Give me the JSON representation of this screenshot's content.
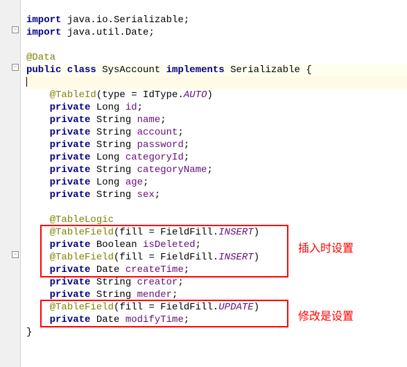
{
  "code": {
    "line1": "import java.io.Serializable;",
    "line1_kw": "import",
    "line1_pkg": " java.io.Serializable;",
    "line2_kw": "import",
    "line2_pkg": " java.util.Date;",
    "line4_ann": "@Data",
    "line5_kw1": "public class",
    "line5_cls": " SysAccount ",
    "line5_kw2": "implements",
    "line5_impl": " Serializable {",
    "line7_ann": "@TableId",
    "line7_paren1": "(type = IdType.",
    "line7_enum": "AUTO",
    "line7_paren2": ")",
    "line8_kw": "private",
    "line8_type": " Long ",
    "line8_field": "id",
    "line8_semi": ";",
    "line9_kw": "private",
    "line9_type": " String ",
    "line9_field": "name",
    "line9_semi": ";",
    "line10_kw": "private",
    "line10_type": " String ",
    "line10_field": "account",
    "line10_semi": ";",
    "line11_kw": "private",
    "line11_type": " String ",
    "line11_field": "password",
    "line11_semi": ";",
    "line12_kw": "private",
    "line12_type": " Long ",
    "line12_field": "categoryId",
    "line12_semi": ";",
    "line13_kw": "private",
    "line13_type": " String ",
    "line13_field": "categoryName",
    "line13_semi": ";",
    "line14_kw": "private",
    "line14_type": " Long ",
    "line14_field": "age",
    "line14_semi": ";",
    "line15_kw": "private",
    "line15_type": " String ",
    "line15_field": "sex",
    "line15_semi": ";",
    "line17_ann": "@TableLogic",
    "line18_ann": "@TableField",
    "line18_paren1": "(fill = FieldFill.",
    "line18_enum": "INSERT",
    "line18_paren2": ")",
    "line19_kw": "private",
    "line19_type": " Boolean ",
    "line19_field": "isDeleted",
    "line19_semi": ";",
    "line20_ann": "@TableField",
    "line20_paren1": "(fill = FieldFill.",
    "line20_enum": "INSERT",
    "line20_paren2": ")",
    "line21_kw": "private",
    "line21_type": " Date ",
    "line21_field": "createTime",
    "line21_semi": ";",
    "line22_kw": "private",
    "line22_type": " String ",
    "line22_field": "creator",
    "line22_semi": ";",
    "line23_kw": "private",
    "line23_type": " String ",
    "line23_field": "mender",
    "line23_semi": ";",
    "line24_ann": "@TableField",
    "line24_paren1": "(fill = FieldFill.",
    "line24_enum": "UPDATE",
    "line24_paren2": ")",
    "line25_kw": "private",
    "line25_type": " Date ",
    "line25_field": "modifyTime",
    "line25_semi": ";",
    "line26_brace": "}"
  },
  "annotations": {
    "insert_label": "插入时设置",
    "update_label": "修改是设置"
  }
}
